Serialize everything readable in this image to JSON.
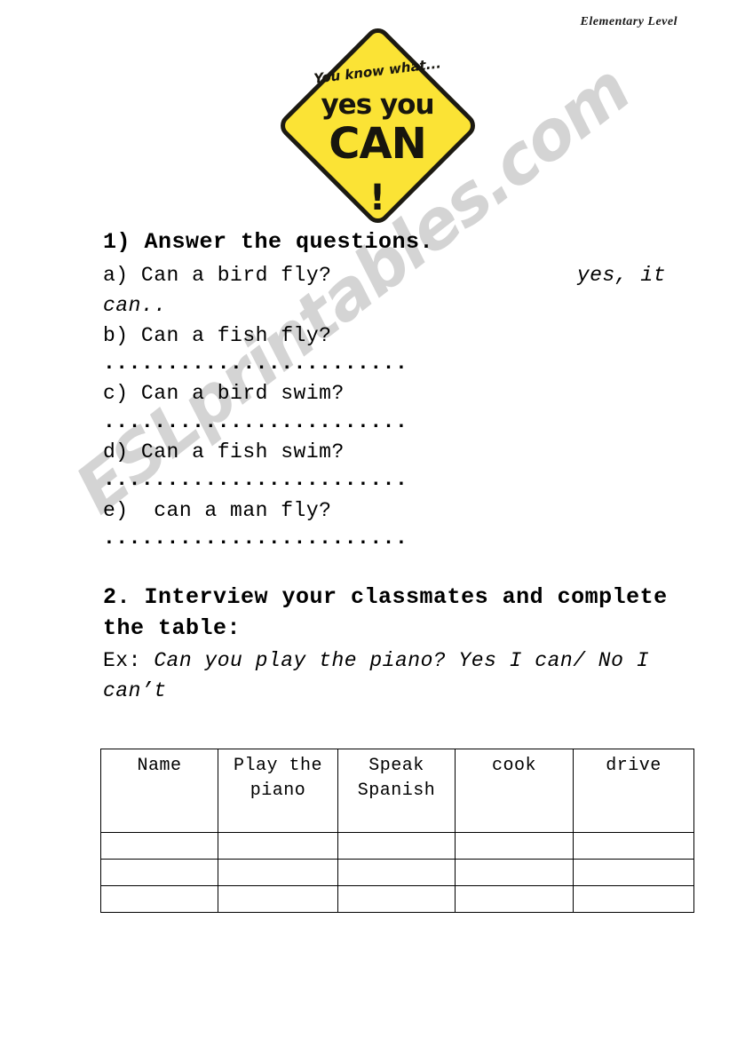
{
  "header": {
    "level_label": "Elementary Level"
  },
  "clipart": {
    "name": "yes-you-can-road-sign",
    "line_script": "You know what...",
    "line_yes": "yes you",
    "line_can": "CAN",
    "line_bang": "!",
    "sign_color": "#fbe335",
    "sign_border_color": "#1c1a12"
  },
  "watermark": {
    "text": "ESLprintables.com"
  },
  "exercise1": {
    "heading": "1) Answer the questions.",
    "items": [
      {
        "label": "a)",
        "question": "Can a bird fly?",
        "answer_inline": "yes, it",
        "answer_wrap": "can..",
        "dots": ""
      },
      {
        "label": "b)",
        "question": "Can a fish fly?",
        "dots": "..............................................."
      },
      {
        "label": "c)",
        "question": "Can a bird swim?",
        "dots": "..............................................."
      },
      {
        "label": "d)",
        "question": "Can a fish swim?",
        "dots": "..............................................."
      },
      {
        "label": "e)",
        "question": " can a man fly?",
        "dots": "..............................................."
      }
    ],
    "line_a": "a) Can a bird fly?",
    "line_b": "b) Can a fish fly?",
    "line_c": "c) Can a bird swim?",
    "line_d": "d) Can a fish swim?",
    "line_e": "e)  can a man fly?"
  },
  "exercise2": {
    "heading": "2. Interview your classmates and complete the table:",
    "example_lead": "Ex: ",
    "example_text": "Can you play the piano? Yes I can/ No I can’t"
  },
  "table": {
    "headers": [
      "Name",
      "Play the piano",
      "Speak Spanish",
      "cook",
      "drive"
    ],
    "rows": [
      [
        "",
        "",
        "",
        "",
        ""
      ],
      [
        "",
        "",
        "",
        "",
        ""
      ],
      [
        "",
        "",
        "",
        "",
        ""
      ]
    ]
  }
}
